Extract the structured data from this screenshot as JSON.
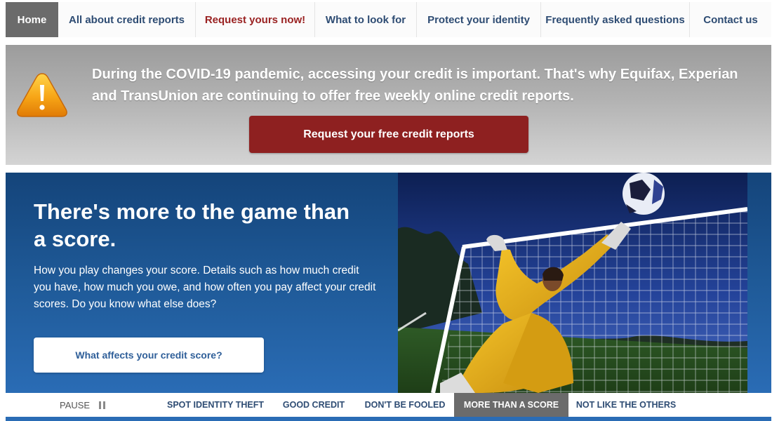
{
  "nav": {
    "items": [
      {
        "label": "Home"
      },
      {
        "label": "All about credit reports"
      },
      {
        "label": "Request yours now!"
      },
      {
        "label": "What to look for"
      },
      {
        "label": "Protect your identity"
      },
      {
        "label": "Frequently asked questions"
      },
      {
        "label": "Contact us"
      }
    ],
    "active_index": 0
  },
  "alert": {
    "icon": "warning-icon",
    "message": "During the COVID-19 pandemic, accessing your credit is important. That's why Equifax, Experian and TransUnion are continuing to offer free weekly online credit reports.",
    "button_label": "Request your free credit reports"
  },
  "hero": {
    "title": "There's more to the game than a score.",
    "body": "How you play changes your score. Details such as how much credit you have, how much you owe, and how often you pay affect your credit scores. Do you know what else does?",
    "button_label": "What affects your credit score?",
    "image": "soccer-goalkeeper-photo"
  },
  "slides": {
    "pause_label": "PAUSE",
    "tabs": [
      {
        "label": "SPOT IDENTITY THEFT"
      },
      {
        "label": "GOOD CREDIT"
      },
      {
        "label": "DON'T BE FOOLED"
      },
      {
        "label": "MORE THAN A SCORE"
      },
      {
        "label": "NOT LIKE THE OTHERS"
      }
    ],
    "active_index": 3
  },
  "colors": {
    "nav_active": "#6b6b6b",
    "nav_text": "#2e4c73",
    "request_text": "#9a2222",
    "alert_button": "#8e2020",
    "hero_blue": "#1f5a98"
  }
}
